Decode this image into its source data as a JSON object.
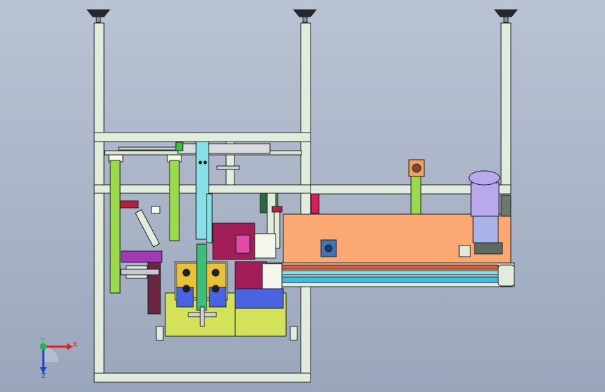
{
  "viewport": {
    "background_top": "#bac3d3",
    "background_bottom": "#9aa6bb"
  },
  "triad": {
    "x_label": "X",
    "y_label": "Y",
    "z_label": "Z",
    "x_color": "#e0201c",
    "y_color": "#22b34a",
    "z_color": "#2346c8"
  },
  "model": {
    "frame_color": "#e2ecdd",
    "edge_color": "#1d2024",
    "conveyor_body_color": "#fba873",
    "motor_color": "#b9a8ee",
    "base_plate_color": "#d4e25a",
    "blue_block_color": "#4a63e0",
    "magenta_color": "#a31e59",
    "cyan_color": "#86e0e6",
    "belt_red_color": "#f0542c",
    "belt_blue_color": "#3fb9e8",
    "green_post_color": "#9bdb4b"
  }
}
